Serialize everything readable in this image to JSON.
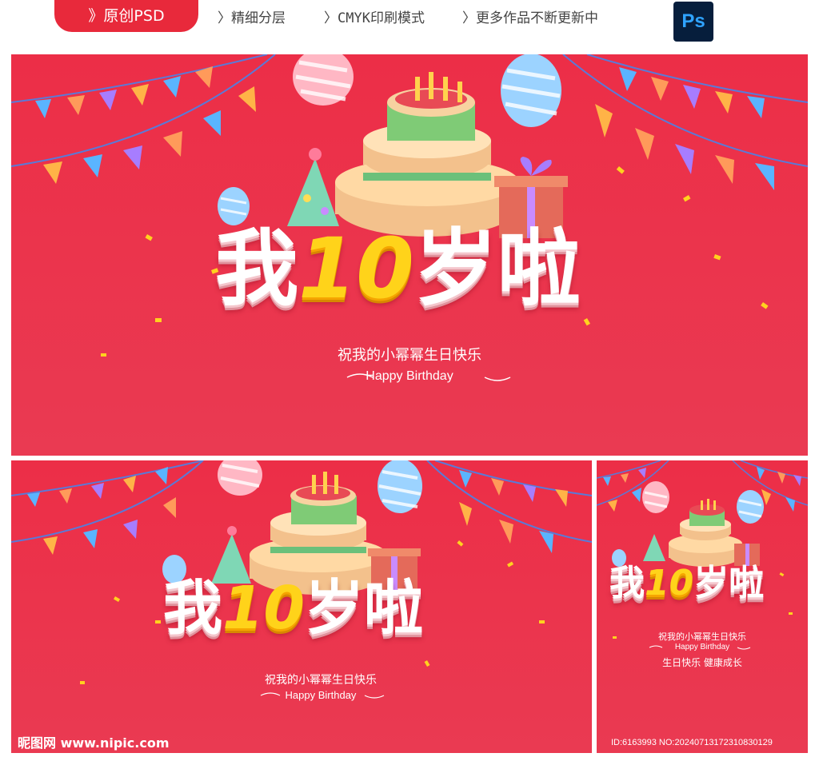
{
  "header": {
    "tag_label": "》原创PSD",
    "features": [
      "〉精细分层",
      "〉CMYK印刷模式",
      "〉更多作品不断更新中"
    ],
    "ps_label": "Ps"
  },
  "poster": {
    "headline_char_1": "我",
    "headline_number": "10",
    "headline_rest": "岁啦",
    "subtitle": "祝我的小幂幂生日快乐",
    "english_line": "Happy Birthday",
    "extra_line": "生日快乐  健康成长"
  },
  "watermark": {
    "site": "昵图网 www.nipic.com",
    "id_line": "ID:6163993 NO:20240713172310830129"
  },
  "colors": {
    "brand_red": "#e8293b",
    "panel_red": "#ec2e47",
    "number_yellow": "#ffd31a"
  }
}
